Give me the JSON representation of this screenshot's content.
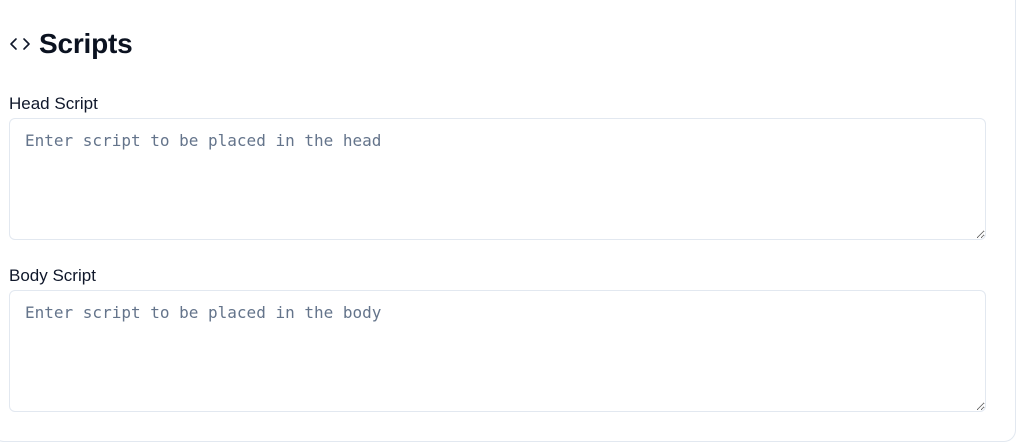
{
  "section": {
    "title": "Scripts",
    "icon": "code-icon"
  },
  "fields": {
    "head": {
      "label": "Head Script",
      "value": "",
      "placeholder": "Enter script to be placed in the head"
    },
    "body": {
      "label": "Body Script",
      "value": "",
      "placeholder": "Enter script to be placed in the body"
    }
  },
  "colors": {
    "border": "#e2e8f0",
    "placeholder": "#64748b",
    "text": "#0f172a"
  }
}
